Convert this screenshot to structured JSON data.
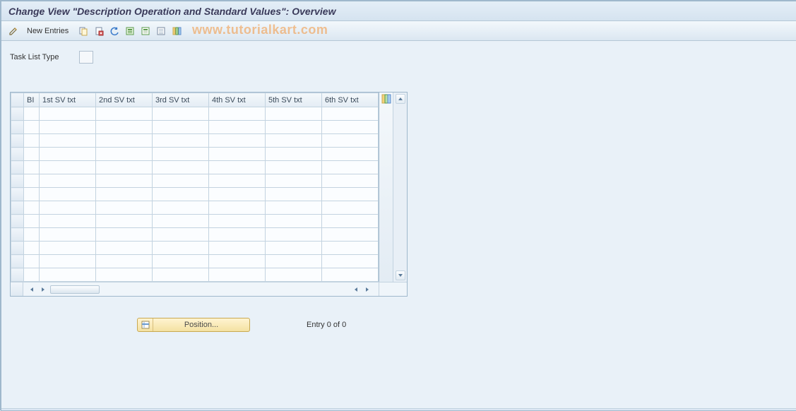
{
  "title": "Change View \"Description Operation and Standard Values\": Overview",
  "toolbar": {
    "new_entries_label": "New Entries"
  },
  "watermark": "www.tutorialkart.com",
  "fields": {
    "task_list_type_label": "Task List Type",
    "task_list_type_value": ""
  },
  "grid": {
    "columns": [
      "BI",
      "1st SV txt",
      "2nd SV txt",
      "3rd SV txt",
      "4th SV txt",
      "5th SV txt",
      "6th SV txt"
    ],
    "rows": [
      [
        "",
        "",
        "",
        "",
        "",
        "",
        ""
      ],
      [
        "",
        "",
        "",
        "",
        "",
        "",
        ""
      ],
      [
        "",
        "",
        "",
        "",
        "",
        "",
        ""
      ],
      [
        "",
        "",
        "",
        "",
        "",
        "",
        ""
      ],
      [
        "",
        "",
        "",
        "",
        "",
        "",
        ""
      ],
      [
        "",
        "",
        "",
        "",
        "",
        "",
        ""
      ],
      [
        "",
        "",
        "",
        "",
        "",
        "",
        ""
      ],
      [
        "",
        "",
        "",
        "",
        "",
        "",
        ""
      ],
      [
        "",
        "",
        "",
        "",
        "",
        "",
        ""
      ],
      [
        "",
        "",
        "",
        "",
        "",
        "",
        ""
      ],
      [
        "",
        "",
        "",
        "",
        "",
        "",
        ""
      ],
      [
        "",
        "",
        "",
        "",
        "",
        "",
        ""
      ],
      [
        "",
        "",
        "",
        "",
        "",
        "",
        ""
      ]
    ]
  },
  "footer": {
    "position_label": "Position...",
    "entry_text": "Entry 0 of 0"
  }
}
